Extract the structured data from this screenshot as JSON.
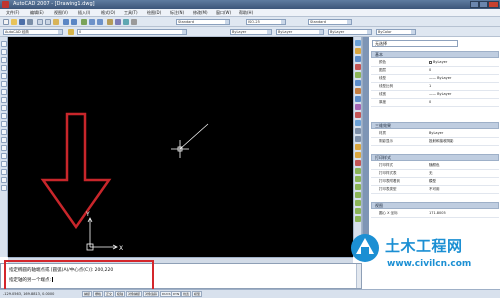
{
  "window": {
    "title": "AutoCAD 2007 - [Drawing1.dwg]"
  },
  "menu": {
    "items": [
      "文件(F)",
      "编辑(E)",
      "视图(V)",
      "插入(I)",
      "格式(O)",
      "工具(T)",
      "绘图(D)",
      "标注(N)",
      "修改(M)",
      "窗口(W)",
      "帮助(H)"
    ]
  },
  "toolbar": {
    "workspace": "AutoCAD 经典",
    "text_style": "Standard",
    "dim_style": "ISO-25",
    "table_style": "Standard",
    "layer": "0",
    "color": "ByLayer",
    "linetype": "ByLayer",
    "lineweight": "ByLayer",
    "plot_style": "ByColor"
  },
  "properties": {
    "selection": "无选择",
    "sections": [
      {
        "title": "基本",
        "rows": [
          {
            "label": "颜色",
            "value": "ByLayer",
            "swatch": true
          },
          {
            "label": "图层",
            "value": "0"
          },
          {
            "label": "线型",
            "value": "—— ByLayer"
          },
          {
            "label": "线型比例",
            "value": "1"
          },
          {
            "label": "线宽",
            "value": "—— ByLayer"
          },
          {
            "label": "厚度",
            "value": "0"
          }
        ]
      },
      {
        "title": "三维效果",
        "rows": [
          {
            "label": "材质",
            "value": "ByLayer"
          },
          {
            "label": "阴影显示",
            "value": "投射和接收阴影"
          }
        ]
      },
      {
        "title": "打印样式",
        "rows": [
          {
            "label": "打印样式",
            "value": "随颜色"
          },
          {
            "label": "打印样式表",
            "value": "无"
          },
          {
            "label": "打印表附着到",
            "value": "模型"
          },
          {
            "label": "打印表类型",
            "value": "不可用"
          }
        ]
      },
      {
        "title": "视图",
        "rows": [
          {
            "label": "圆心 X 坐标",
            "value": "171.8005"
          }
        ]
      }
    ]
  },
  "command": {
    "line1": "指定椭圆的轴端点或 [圆弧(A)/中心点(C)]: 200,220",
    "line2": "指定轴的另一个端点:"
  },
  "status": {
    "coords": "-129.0563, 169.8813, 0.0000",
    "toggles": [
      "捕捉",
      "栅格",
      "正交",
      "极轴",
      "对象捕捉",
      "对象追踪",
      "DUCS",
      "DYN",
      "线宽",
      "模型"
    ]
  },
  "ucs": {
    "x_label": "X",
    "y_label": "Y"
  },
  "watermark": {
    "name": "土木工程网",
    "url": "www.civilcn.com"
  },
  "colors": {
    "canvas": "#000000",
    "arrow": "#c8262b",
    "highlight": "#d4262b",
    "brand": "#1b8fd3"
  }
}
